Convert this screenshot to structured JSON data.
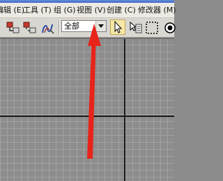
{
  "menubar": {
    "items": [
      {
        "label": "编辑 (E)"
      },
      {
        "label": "工具 (T)"
      },
      {
        "label": "组 (G)"
      },
      {
        "label": "视图 (V)"
      },
      {
        "label": "创建 (C)"
      },
      {
        "label": "修改器 (M)"
      }
    ]
  },
  "toolbar": {
    "filter_dropdown": {
      "selected": "全部"
    },
    "icons": [
      "link-icon",
      "unlink-icon",
      "bind-space-warp-icon",
      "select-arrow-icon",
      "select-by-name-icon",
      "rectangular-region-icon",
      "window-crossing-icon"
    ]
  },
  "annotation": {
    "arrow_color": "#e8241a"
  },
  "colors": {
    "menubar_bg": "#eceae3",
    "toolbar_bg": "#d9d7d1",
    "viewport_bg": "#8d8d8d",
    "grid_line": "#a2a2a2",
    "axis_line": "#1a1a1a"
  }
}
